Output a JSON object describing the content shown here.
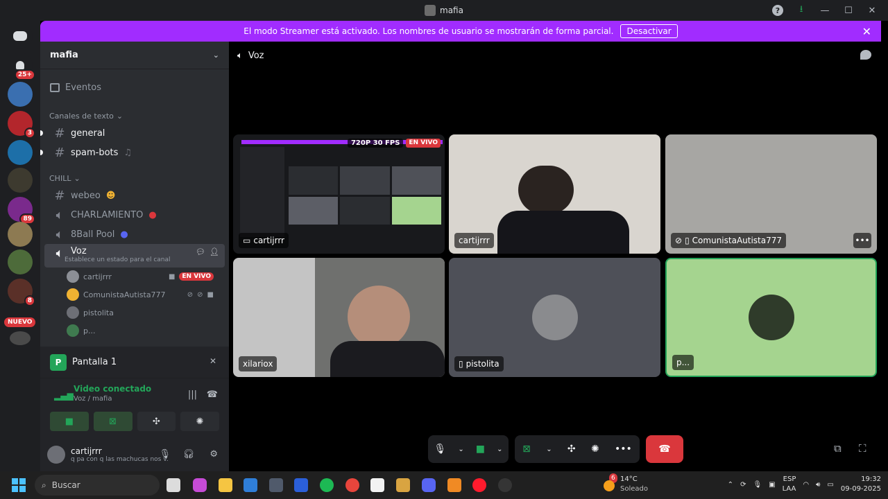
{
  "window": {
    "title": "mafia"
  },
  "streamer": {
    "message": "El modo Streamer está activado. Los nombres de usuario se mostrarán de forma parcial.",
    "button": "Desactivar"
  },
  "rail": {
    "badges": [
      "25+",
      "3",
      "89",
      "8"
    ],
    "nuevo": "NUEVO"
  },
  "sidebar": {
    "guild": "mafia",
    "events": "Eventos",
    "cat_text": "Canales de texto",
    "cat_chill": "CHILL",
    "channels": {
      "general": "general",
      "spam": "spam-bots",
      "webeo": "webeo",
      "charla": "CHARLAMIENTO",
      "ball": "8Ball Pool",
      "voz": "Voz",
      "voz_status": "Establece un estado para el canal"
    },
    "voice_users": [
      "cartijrrr",
      "ComunistaAutista777",
      "pistolita",
      "p..."
    ],
    "live_badge": "EN VIVO"
  },
  "panel": {
    "share_title": "Pantalla 1",
    "share_letter": "P",
    "conn_status": "Video conectado",
    "conn_channel": "Voz / mafia",
    "user_name": "cartijrrr",
    "user_status": "q pa con q las machucas nos v..."
  },
  "main": {
    "channel_title": "Voz",
    "tiles": {
      "t1_name": "cartijrrr",
      "t1_quality": "720P 30 FPS",
      "t1_live": "EN VIVO",
      "t2_name": "cartijrrr",
      "t3_name": "ComunistaAutista777",
      "t4_name": "xilariox",
      "t5_name": "pistolita",
      "t6_name": "p..."
    }
  },
  "taskbar": {
    "search": "Buscar",
    "temp": "14°C",
    "weather": "Soleado",
    "weather_badge": "6",
    "lang1": "ESP",
    "lang2": "LAA",
    "time": "19:32",
    "date": "09-09-2025"
  },
  "colors": {
    "streamer": "#a12cff",
    "live": "#da373c",
    "connected": "#23a559",
    "green_tile": "#a5d48f"
  }
}
